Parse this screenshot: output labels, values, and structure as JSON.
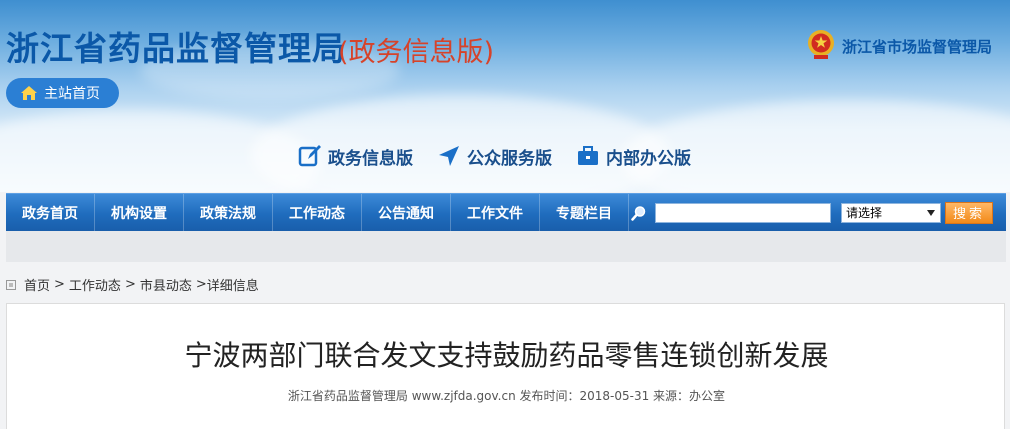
{
  "header": {
    "site_title": "浙江省药品监督管理局",
    "site_subtitle": "(政务信息版)",
    "bureau_name": "浙江省市场监督管理局",
    "home_button": "主站首页"
  },
  "versions": [
    {
      "label": "政务信息版",
      "icon": "edit-icon"
    },
    {
      "label": "公众服务版",
      "icon": "paper-plane-icon"
    },
    {
      "label": "内部办公版",
      "icon": "briefcase-icon"
    }
  ],
  "nav": {
    "items": [
      "政务首页",
      "机构设置",
      "政策法规",
      "工作动态",
      "公告通知",
      "工作文件",
      "专题栏目"
    ],
    "search_placeholder": "",
    "select_value": "请选择",
    "search_button": "搜索"
  },
  "breadcrumb": {
    "items": [
      "首页",
      "工作动态",
      "市县动态",
      "详细信息"
    ],
    "separator": ">"
  },
  "article": {
    "title": "宁波两部门联合发文支持鼓励药品零售连锁创新发展",
    "meta": "浙江省药品监督管理局 www.zjfda.gov.cn 发布时间：2018-05-31 来源：办公室"
  },
  "colors": {
    "brand_blue": "#0b58a8",
    "subtitle_red": "#d6432a",
    "nav_blue": "#1f6cbd",
    "search_orange": "#f28a1a"
  }
}
